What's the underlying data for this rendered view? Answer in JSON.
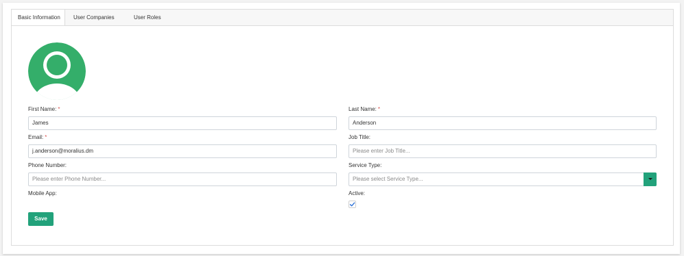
{
  "tabs": [
    {
      "label": "Basic Information",
      "active": true
    },
    {
      "label": "User Companies",
      "active": false
    },
    {
      "label": "User Roles",
      "active": false
    }
  ],
  "avatar": {
    "icon": "user-avatar-icon",
    "color": "#34ae6a"
  },
  "form": {
    "first_name": {
      "label": "First Name:",
      "required_mark": "*",
      "value": "James"
    },
    "last_name": {
      "label": "Last Name:",
      "required_mark": "*",
      "value": "Anderson"
    },
    "email": {
      "label": "Email:",
      "required_mark": "*",
      "value": "j.anderson@moralius.dm"
    },
    "job_title": {
      "label": "Job Title:",
      "placeholder": "Please enter Job Title..."
    },
    "phone_number": {
      "label": "Phone Number:",
      "placeholder": "Please enter Phone Number..."
    },
    "service_type": {
      "label": "Service Type:",
      "placeholder": "Please select Service Type..."
    },
    "mobile_app": {
      "label": "Mobile App:"
    },
    "active": {
      "label": "Active:",
      "checked": true
    }
  },
  "save_label": "Save",
  "colors": {
    "accent": "#22a27b",
    "avatar": "#34ae6a",
    "required": "#d9534f",
    "check": "#2a6fd6"
  }
}
